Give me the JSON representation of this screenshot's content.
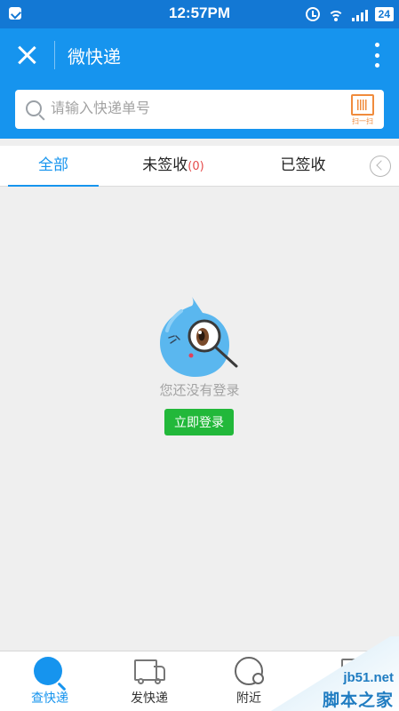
{
  "status_bar": {
    "time": "12:57PM",
    "battery": "24"
  },
  "header": {
    "title": "微快递",
    "search_placeholder": "请输入快递单号",
    "scan_label": "扫一扫"
  },
  "tabs": [
    {
      "label": "全部",
      "count": "",
      "active": true
    },
    {
      "label": "未签收",
      "count": "(0)",
      "active": false
    },
    {
      "label": "已签收",
      "count": "",
      "active": false
    }
  ],
  "empty_state": {
    "message": "您还没有登录",
    "login_button": "立即登录"
  },
  "bottom_nav": [
    {
      "label": "查快递",
      "icon": "search-express-icon",
      "active": true
    },
    {
      "label": "发快递",
      "icon": "truck-icon",
      "active": false
    },
    {
      "label": "附近",
      "icon": "nearby-icon",
      "active": false
    },
    {
      "label": "",
      "icon": "profile-icon",
      "active": false
    }
  ],
  "watermark": {
    "url": "jb51.net",
    "name": "脚本之家"
  },
  "colors": {
    "status_bar": "#1378d4",
    "header": "#1694ee",
    "active_tab": "#1694ee",
    "login_button": "#22b83a",
    "count_red": "#e54b4b",
    "scan_orange": "#f08b3c"
  }
}
